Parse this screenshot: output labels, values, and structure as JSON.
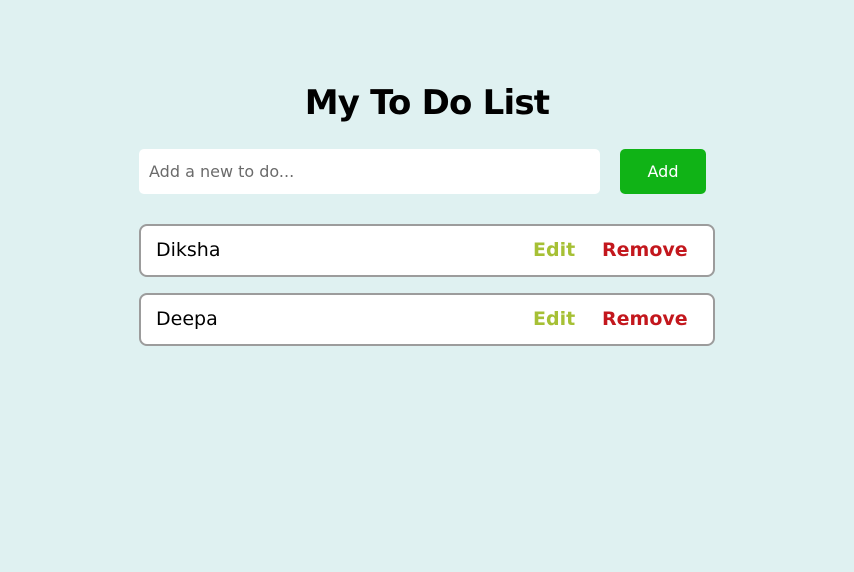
{
  "header": {
    "title": "My To Do List"
  },
  "input": {
    "value": "",
    "placeholder": "Add a new to do..."
  },
  "add_button": {
    "label": "Add"
  },
  "todos": [
    {
      "text": "Diksha",
      "edit_label": "Edit",
      "remove_label": "Remove"
    },
    {
      "text": "Deepa",
      "edit_label": "Edit",
      "remove_label": "Remove"
    }
  ],
  "colors": {
    "background": "#dff1f1",
    "add_button": "#10b316",
    "edit": "#a6c035",
    "remove": "#c3171d",
    "item_border": "#9c9c9c"
  }
}
